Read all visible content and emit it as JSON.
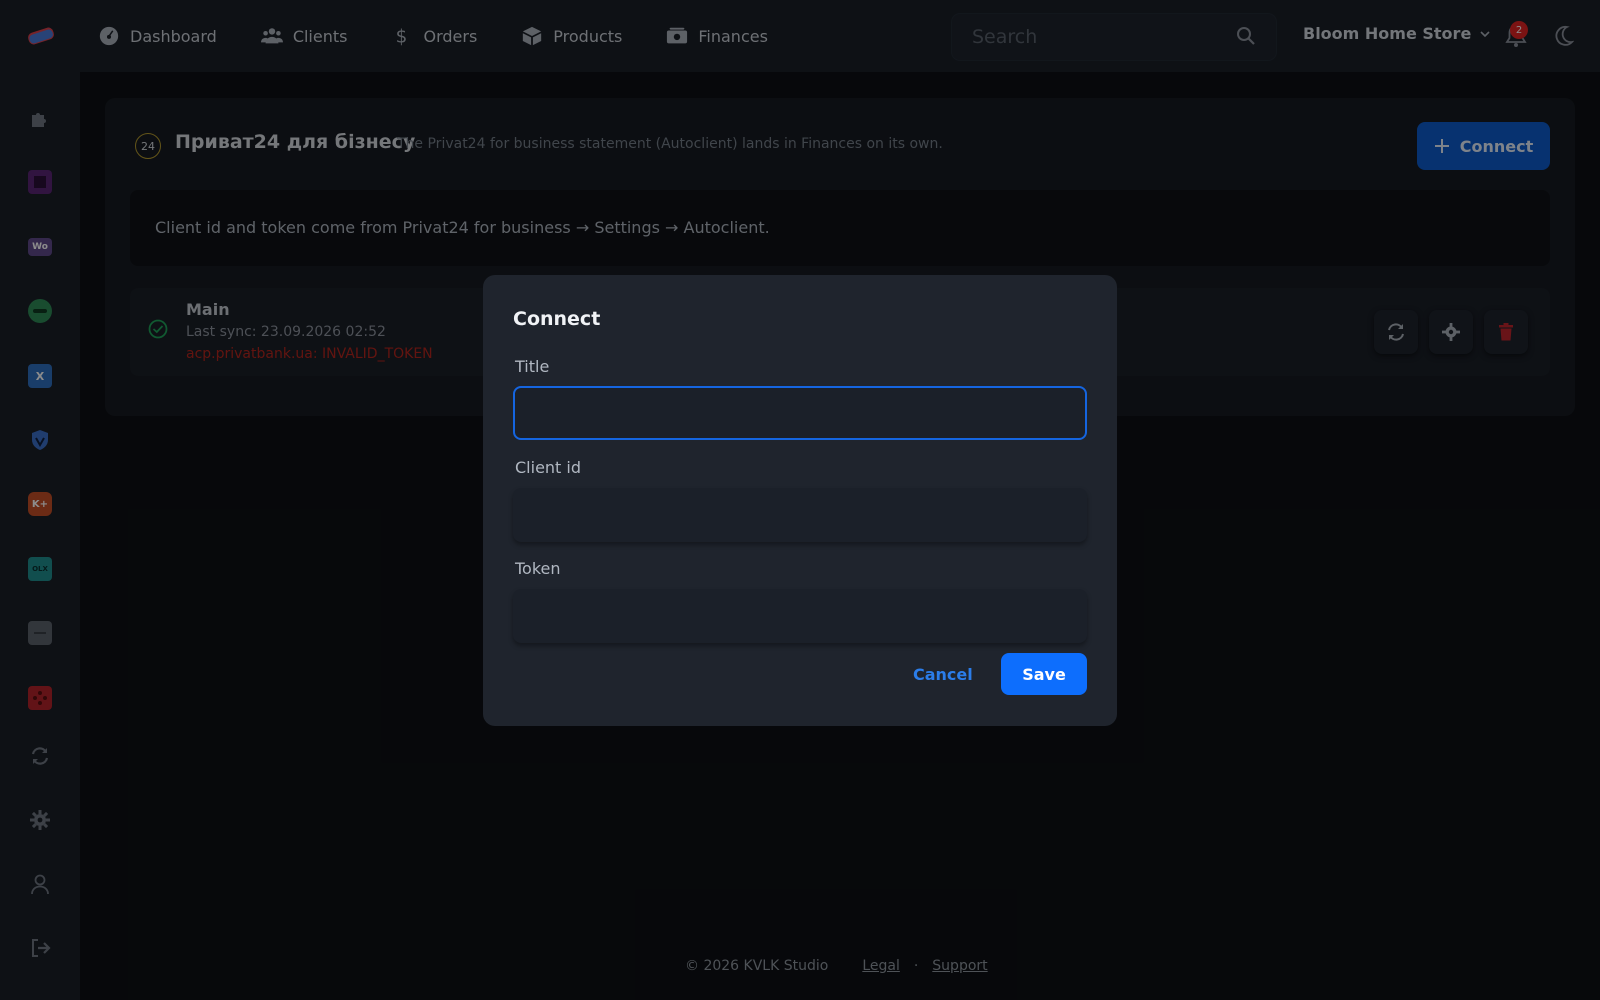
{
  "header": {
    "nav": [
      {
        "label": "Dashboard",
        "icon": "gauge-icon"
      },
      {
        "label": "Clients",
        "icon": "users-icon"
      },
      {
        "label": "Orders",
        "icon": "dollar-icon"
      },
      {
        "label": "Products",
        "icon": "box-icon"
      },
      {
        "label": "Finances",
        "icon": "money-icon"
      }
    ],
    "search_placeholder": "Search",
    "store_name": "Bloom Home Store",
    "notification_count": "2"
  },
  "sidebar": {
    "items": [
      {
        "name": "puzzle-icon",
        "color": "#7b8490"
      },
      {
        "name": "square-app-icon",
        "color": "#6b2a8a"
      },
      {
        "name": "woocommerce-icon",
        "color": "#5f4a8b",
        "text": "Wo"
      },
      {
        "name": "green-app-icon",
        "color": "#2e8b57"
      },
      {
        "name": "x-app-icon",
        "color": "#2f6fbf",
        "text": "X"
      },
      {
        "name": "shield-app-icon",
        "color": "#3b6fc9"
      },
      {
        "name": "kplus-app-icon",
        "color": "#d2552a",
        "text": "K+"
      },
      {
        "name": "olx-app-icon",
        "color": "#1f8f8f",
        "text": "OLX"
      },
      {
        "name": "grey-app-icon",
        "color": "#6c737d"
      },
      {
        "name": "red-app-icon",
        "color": "#c0262d"
      },
      {
        "name": "sync-icon",
        "color": "#7b8490"
      },
      {
        "name": "gear-icon",
        "color": "#7b8490"
      },
      {
        "name": "user-icon",
        "color": "#7b8490"
      },
      {
        "name": "logout-icon",
        "color": "#7b8490"
      }
    ]
  },
  "page": {
    "icon_text": "24",
    "title": "Приват24 для бізнесу",
    "subtitle": "The Privat24 for business statement (Autoclient) lands in Finances on its own.",
    "connect_label": "Connect",
    "info": "Client id and token come from Privat24 for business → Settings → Autoclient.",
    "account": {
      "name": "Main",
      "last_sync": "Last sync: 23.09.2026 02:52",
      "error": "acp.privatbank.ua: INVALID_TOKEN"
    }
  },
  "modal": {
    "title": "Connect",
    "fields": [
      {
        "label": "Title",
        "value": ""
      },
      {
        "label": "Client id",
        "value": ""
      },
      {
        "label": "Token",
        "value": ""
      }
    ],
    "cancel_label": "Cancel",
    "save_label": "Save"
  },
  "footer": {
    "copyright": "© 2026 KVLK Studio",
    "legal": "Legal",
    "separator": "·",
    "support": "Support"
  },
  "colors": {
    "accent": "#0d6efd",
    "error": "#b3261e",
    "success": "#1fa35a"
  }
}
